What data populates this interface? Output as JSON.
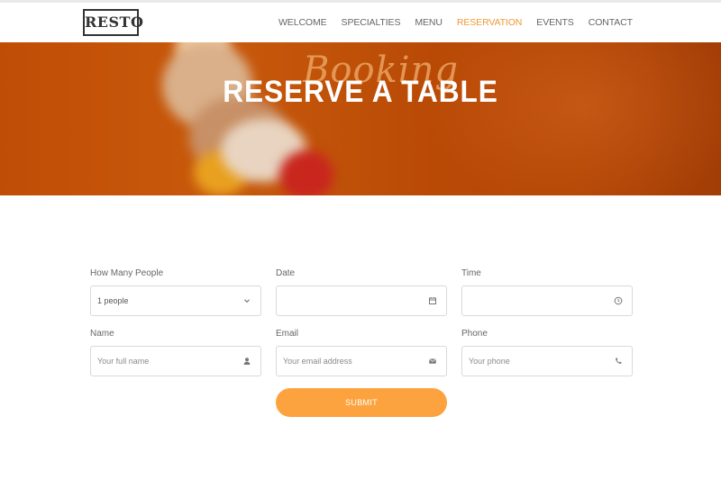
{
  "header": {
    "logo": "RESTO",
    "nav": [
      {
        "label": "WELCOME"
      },
      {
        "label": "SPECIALTIES"
      },
      {
        "label": "MENU"
      },
      {
        "label": "RESERVATION",
        "active": true
      },
      {
        "label": "EVENTS"
      },
      {
        "label": "CONTACT"
      }
    ]
  },
  "hero": {
    "script": "Booking",
    "title": "RESERVE A TABLE"
  },
  "form": {
    "people": {
      "label": "How Many People",
      "value": "1 people",
      "icon": "chevron-down-icon"
    },
    "date": {
      "label": "Date",
      "value": "",
      "icon": "calendar-icon"
    },
    "time": {
      "label": "Time",
      "value": "",
      "icon": "clock-icon"
    },
    "name": {
      "label": "Name",
      "placeholder": "Your full name",
      "icon": "user-icon"
    },
    "email": {
      "label": "Email",
      "placeholder": "Your email address",
      "icon": "envelope-icon"
    },
    "phone": {
      "label": "Phone",
      "placeholder": "Your phone",
      "icon": "phone-icon"
    },
    "submit_label": "SUBMIT"
  },
  "colors": {
    "accent": "#fca33f",
    "nav_active": "#ee9a35",
    "hero_bg": "#c04d05"
  }
}
